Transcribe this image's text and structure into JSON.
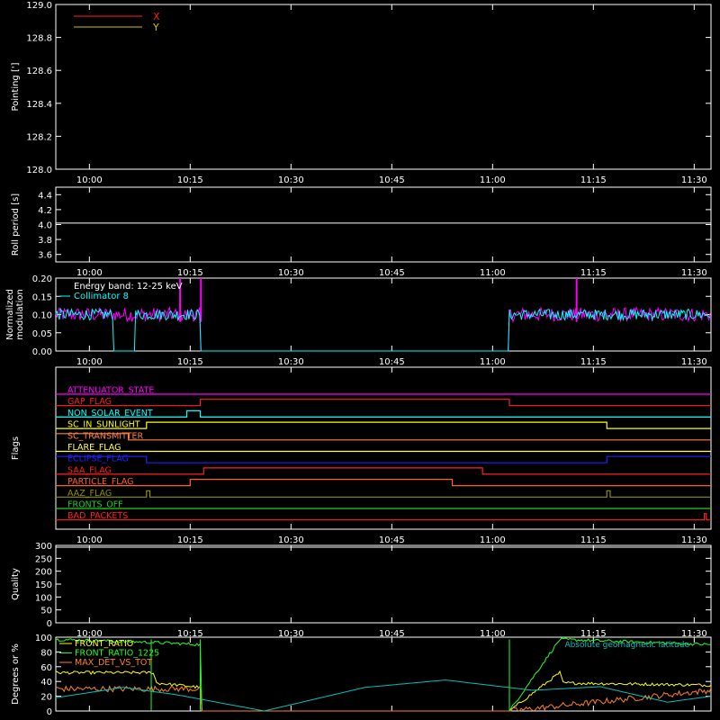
{
  "chart_data": [
    {
      "type": "line",
      "ylabel": "Pointing [']",
      "ylim": [
        128.0,
        129.0
      ],
      "yticks": [
        "128.0",
        "128.2",
        "128.4",
        "128.6",
        "128.8",
        "129.0"
      ],
      "xticks": [
        "10:00",
        "10:15",
        "10:30",
        "10:45",
        "11:00",
        "11:15",
        "11:30"
      ],
      "legend": [
        {
          "name": "X",
          "color": "#ff2020"
        },
        {
          "name": "Y",
          "color": "#c8c800"
        }
      ],
      "legend_position": "top-left",
      "series": []
    },
    {
      "type": "line",
      "ylabel": "Roll period [s]",
      "ylim": [
        3.5,
        4.5
      ],
      "yticks": [
        "3.6",
        "3.8",
        "4.0",
        "4.2",
        "4.4"
      ],
      "xticks": [
        "10:00",
        "10:15",
        "10:30",
        "10:45",
        "11:00",
        "11:15",
        "11:30"
      ],
      "series": [
        {
          "color": "#ffffff",
          "x": [
            0,
            97.5
          ],
          "y": [
            4.02,
            4.02
          ]
        }
      ]
    },
    {
      "type": "line",
      "ylabel": "Normalized modulation",
      "ylim": [
        0.0,
        0.2
      ],
      "yticks": [
        "0.00",
        "0.05",
        "0.10",
        "0.15",
        "0.20"
      ],
      "xticks": [
        "10:00",
        "10:15",
        "10:30",
        "10:45",
        "11:00",
        "11:15",
        "11:30"
      ],
      "legend": [
        {
          "name": "Energy band: 12-25 keV",
          "color": "#ffffff"
        },
        {
          "name": "Collimator 8",
          "color": "#00ffff"
        }
      ],
      "legend_position": "top-left",
      "data_gaps": [
        [
          21.5,
          67.5
        ]
      ],
      "mean_value": 0.1,
      "noise_amplitude": 0.015,
      "series": [
        {
          "color": "#ff00ff",
          "x": [
            0,
            21.5,
            67.5,
            97.5
          ],
          "y": [
            0.1,
            0.1,
            0.1,
            0.1
          ],
          "dips_to_zero_at": [
            21.5,
            67.5
          ],
          "spikes": [
            [
              18.5,
              0.2
            ],
            [
              21.6,
              0.2
            ],
            [
              77.5,
              0.2
            ]
          ]
        },
        {
          "color": "#00ffff",
          "x": [
            0,
            21.5,
            67.5,
            97.5
          ],
          "y": [
            0.1,
            0.1,
            0.1,
            0.1
          ],
          "dips_to_zero_at": [
            8.6,
            11.7
          ]
        }
      ]
    },
    {
      "type": "line",
      "ylabel": "Flags",
      "xticks": [
        "10:00",
        "10:15",
        "10:30",
        "10:45",
        "11:00",
        "11:15",
        "11:30"
      ],
      "flags": [
        {
          "name": "ATTENUATOR_STATE",
          "color": "#ff00ff",
          "steps": []
        },
        {
          "name": "GAP_FLAG",
          "color": "#ff2020",
          "steps": [
            [
              0,
              0
            ],
            [
              21.5,
              1
            ],
            [
              67.5,
              0
            ]
          ]
        },
        {
          "name": "NON_SOLAR_EVENT",
          "color": "#00ffff",
          "steps": [
            [
              0,
              0
            ],
            [
              19.5,
              1
            ],
            [
              21.5,
              0
            ]
          ]
        },
        {
          "name": "SC_IN_SUNLIGHT",
          "color": "#ffff00",
          "steps": [
            [
              0,
              0
            ],
            [
              13.5,
              1
            ],
            [
              82,
              0
            ]
          ]
        },
        {
          "name": "SC_TRANSMITTER",
          "color": "#ff8040",
          "steps": [
            [
              0,
              1
            ],
            [
              10.8,
              0
            ]
          ]
        },
        {
          "name": "FLARE_FLAG",
          "color": "#ffff60",
          "steps": []
        },
        {
          "name": "ECLIPSE_FLAG",
          "color": "#2020ff",
          "steps": [
            [
              0,
              1
            ],
            [
              13.5,
              0
            ],
            [
              82,
              1
            ]
          ]
        },
        {
          "name": "SAA_FLAG",
          "color": "#ff2020",
          "steps": [
            [
              0,
              0
            ],
            [
              22,
              1
            ],
            [
              63.5,
              0
            ]
          ]
        },
        {
          "name": "PARTICLE_FLAG",
          "color": "#ff6020",
          "steps": [
            [
              0,
              0
            ],
            [
              20,
              1
            ],
            [
              59,
              0
            ]
          ]
        },
        {
          "name": "AAZ_FLAG",
          "color": "#909000",
          "steps": [
            [
              0,
              0
            ],
            [
              13.5,
              1
            ],
            [
              14,
              0
            ],
            [
              82,
              1
            ],
            [
              82.5,
              0
            ]
          ]
        },
        {
          "name": "FRONTS_OFF",
          "color": "#20d020",
          "steps": []
        },
        {
          "name": "BAD_PACKETS",
          "color": "#ff2020",
          "steps": [
            [
              0,
              0
            ],
            [
              96.5,
              1
            ],
            [
              96.8,
              0
            ]
          ]
        }
      ]
    },
    {
      "type": "line",
      "ylabel": "Quality",
      "ylim": [
        0,
        300
      ],
      "yticks": [
        "0",
        "50",
        "100",
        "150",
        "200",
        "250",
        "300"
      ],
      "xticks": [
        "10:00",
        "10:15",
        "10:30",
        "10:45",
        "11:00",
        "11:15",
        "11:30"
      ],
      "series": [
        {
          "color": "#ffffff",
          "x": [
            0,
            97.5
          ],
          "y": [
            300,
            300
          ]
        }
      ]
    },
    {
      "type": "line",
      "ylabel": "Degrees or %",
      "ylim": [
        0,
        100
      ],
      "yticks": [
        "0",
        "20",
        "40",
        "60",
        "80",
        "100"
      ],
      "legend": [
        {
          "name": "FRONT_RATIO",
          "color": "#ffff00"
        },
        {
          "name": "FRONT_RATIO_1225",
          "color": "#20ff20"
        },
        {
          "name": "MAX_DET_VS_TOT",
          "color": "#ff8020"
        }
      ],
      "legend_position": "top-left",
      "right_annotation": {
        "name": "Absolute geomagnetic latitude",
        "color": "#00c0c0"
      },
      "series": [
        {
          "name": "FRONT_RATIO",
          "color": "#ffff00",
          "x": [
            0,
            14.5,
            15,
            21.5,
            67.5,
            75,
            75.5,
            97.5
          ],
          "y": [
            52,
            52,
            38,
            32,
            0,
            52,
            38,
            35
          ]
        },
        {
          "name": "FRONT_RATIO_1225",
          "color": "#20ff20",
          "x": [
            0,
            14.5,
            21.5,
            67.5,
            75,
            97.5
          ],
          "y": [
            97,
            93,
            90,
            0,
            97,
            90
          ]
        },
        {
          "name": "MAX_DET_VS_TOT",
          "color": "#ff8020",
          "x": [
            0,
            21.5,
            67.5,
            97.5
          ],
          "y": [
            30,
            30,
            0,
            28
          ]
        },
        {
          "name": "Absolute geomagnetic latitude",
          "color": "#00c0c0",
          "x": [
            0,
            10,
            18,
            31,
            46,
            58,
            71,
            81,
            91,
            97.5
          ],
          "y": [
            18,
            32,
            22,
            0,
            32,
            42,
            28,
            33,
            12,
            20
          ]
        }
      ]
    }
  ]
}
